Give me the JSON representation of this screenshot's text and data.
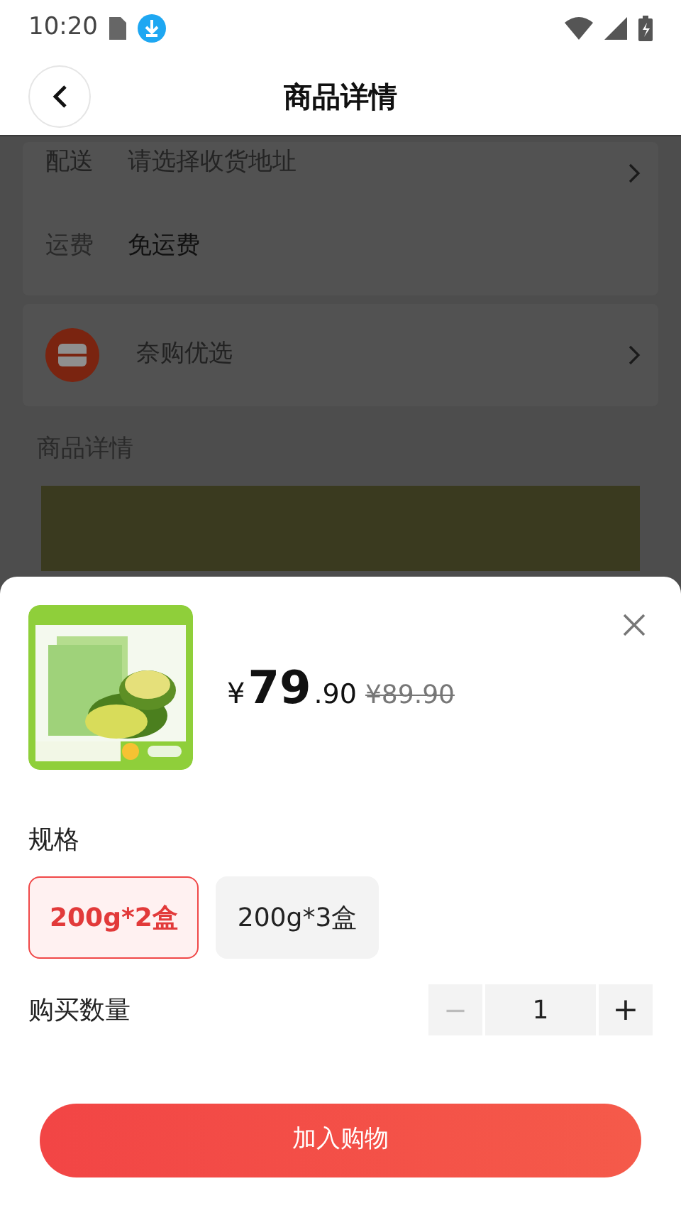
{
  "status_bar": {
    "time": "10:20"
  },
  "header": {
    "title": "商品详情"
  },
  "background": {
    "delivery": {
      "label": "配送",
      "address_hint": "请选择收货地址"
    },
    "shipping": {
      "label": "运费",
      "value": "免运费"
    },
    "shop": {
      "name": "奈购优选"
    },
    "details_heading": "商品详情"
  },
  "sheet": {
    "product": {
      "price_symbol": "¥",
      "price_int": "79",
      "price_dec": ".90",
      "original_price": "¥89.90"
    },
    "spec_label": "规格",
    "options": [
      {
        "label": "200g*2盒",
        "selected": true
      },
      {
        "label": "200g*3盒",
        "selected": false
      }
    ],
    "quantity": {
      "label": "购买数量",
      "value": "1",
      "minus": "−",
      "plus": "+",
      "minus_disabled": true,
      "plus_disabled": false
    },
    "add_to_cart": "加入购物"
  }
}
